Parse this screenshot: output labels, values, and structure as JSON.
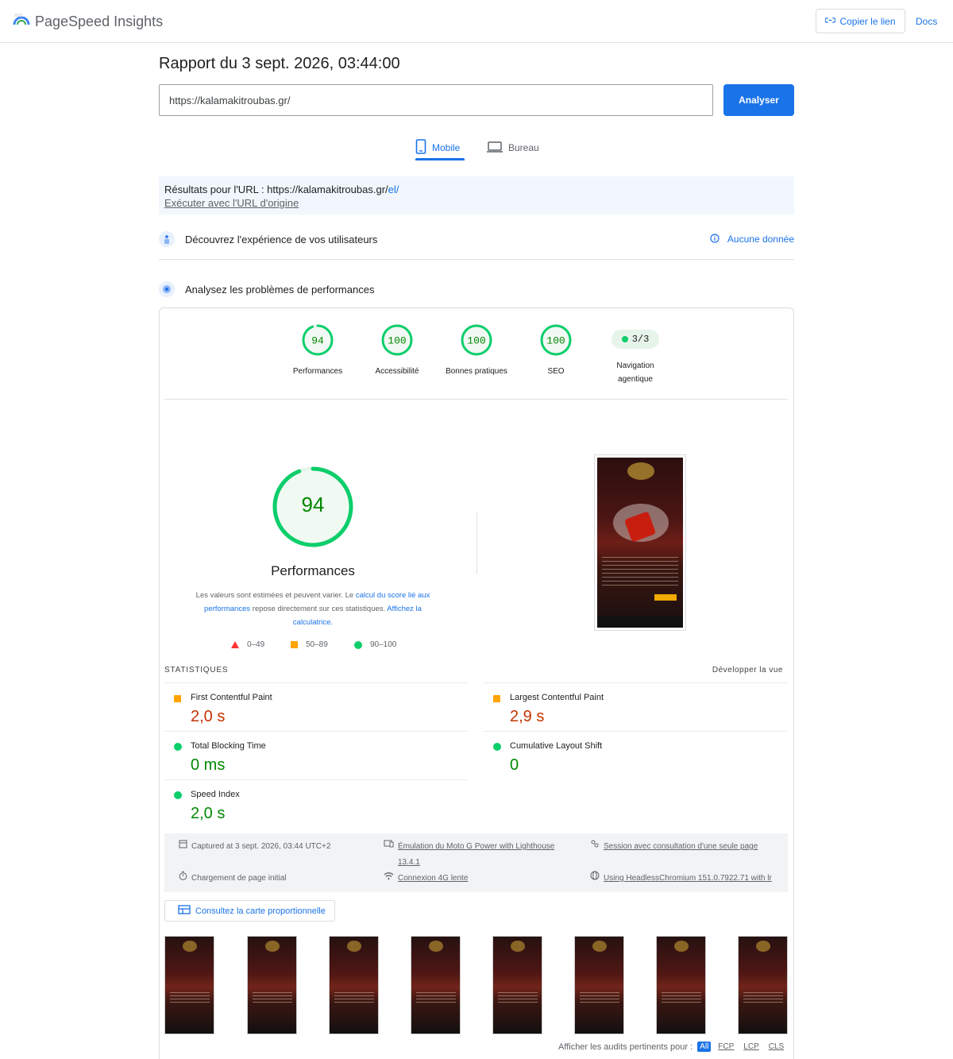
{
  "app": {
    "name": "PageSpeed Insights"
  },
  "header": {
    "copy_link": "Copier le lien",
    "docs": "Docs"
  },
  "report": {
    "title": "Rapport du 3 sept. 2026, 03:44:00",
    "url_value": "https://kalamakitroubas.gr/",
    "analyze_label": "Analyser"
  },
  "tabs": [
    {
      "label": "Mobile",
      "active": true
    },
    {
      "label": "Bureau",
      "active": false
    }
  ],
  "results": {
    "prefix": "Résultats pour l'URL : ",
    "url_base": "https://kalamakitroubas.gr/",
    "url_suffix": "el/",
    "run_original": "Exécuter avec l'URL d'origine"
  },
  "sections": {
    "experience": "Découvrez l'expérience de vos utilisateurs",
    "no_data": "Aucune donnée",
    "performance": "Analysez les problèmes de performances"
  },
  "categories": [
    {
      "score": "94",
      "label": "Performances",
      "fraction": 0.94
    },
    {
      "score": "100",
      "label": "Accessibilité",
      "fraction": 1.0
    },
    {
      "score": "100",
      "label": "Bonnes pratiques",
      "fraction": 1.0
    },
    {
      "score": "100",
      "label": "SEO",
      "fraction": 1.0
    }
  ],
  "agentic": {
    "value": "3/3",
    "label_line1": "Navigation",
    "label_line2": "agentique"
  },
  "main_score": {
    "score": "94",
    "label": "Performances",
    "fraction": 0.94
  },
  "disclaimer": {
    "text1": "Les valeurs sont estimées et peuvent varier. Le ",
    "link1": "calcul du score lié aux performances",
    "text2": " repose directement sur ces statistiques. ",
    "link2": "Affichez la calculatrice."
  },
  "legend": {
    "fail": "0–49",
    "average": "50–89",
    "pass": "90–100"
  },
  "stats": {
    "heading": "STATISTIQUES",
    "expand": "Développer la vue",
    "metrics": [
      {
        "name": "First Contentful Paint",
        "value": "2,0 s",
        "rating": "average"
      },
      {
        "name": "Largest Contentful Paint",
        "value": "2,9 s",
        "rating": "average"
      },
      {
        "name": "Total Blocking Time",
        "value": "0 ms",
        "rating": "pass"
      },
      {
        "name": "Cumulative Layout Shift",
        "value": "0",
        "rating": "pass"
      },
      {
        "name": "Speed Index",
        "value": "2,0 s",
        "rating": "pass"
      }
    ]
  },
  "runtime": {
    "captured": "Captured at 3 sept. 2026, 03:44 UTC+2",
    "emulation_1": "Émulation du Moto G Power with Lighthouse",
    "emulation_2": "13.4.1",
    "session": "Session avec consultation d'une seule page",
    "load": "Chargement de page initial",
    "connection": "Connexion 4G lente",
    "browser": "Using HeadlessChromium 151.0.7922.71 with lr"
  },
  "treemap": {
    "label": "Consultez la carte proportionnelle"
  },
  "audits_filter": {
    "prefix": "Afficher les audits pertinents pour :",
    "chips": [
      "All",
      "FCP",
      "LCP",
      "CLS"
    ]
  },
  "colors": {
    "accent": "#1a73e8",
    "pass": "#0cce6b",
    "average": "#ffa400",
    "fail": "#ff3333"
  },
  "icons": [
    "psi-logo-icon",
    "link-icon",
    "mobile-icon",
    "desktop-icon",
    "users-icon",
    "info-icon",
    "performance-icon",
    "calendar-icon",
    "device-icon",
    "users-group-icon",
    "timer-icon",
    "wifi-icon",
    "globe-icon",
    "treemap-icon"
  ]
}
